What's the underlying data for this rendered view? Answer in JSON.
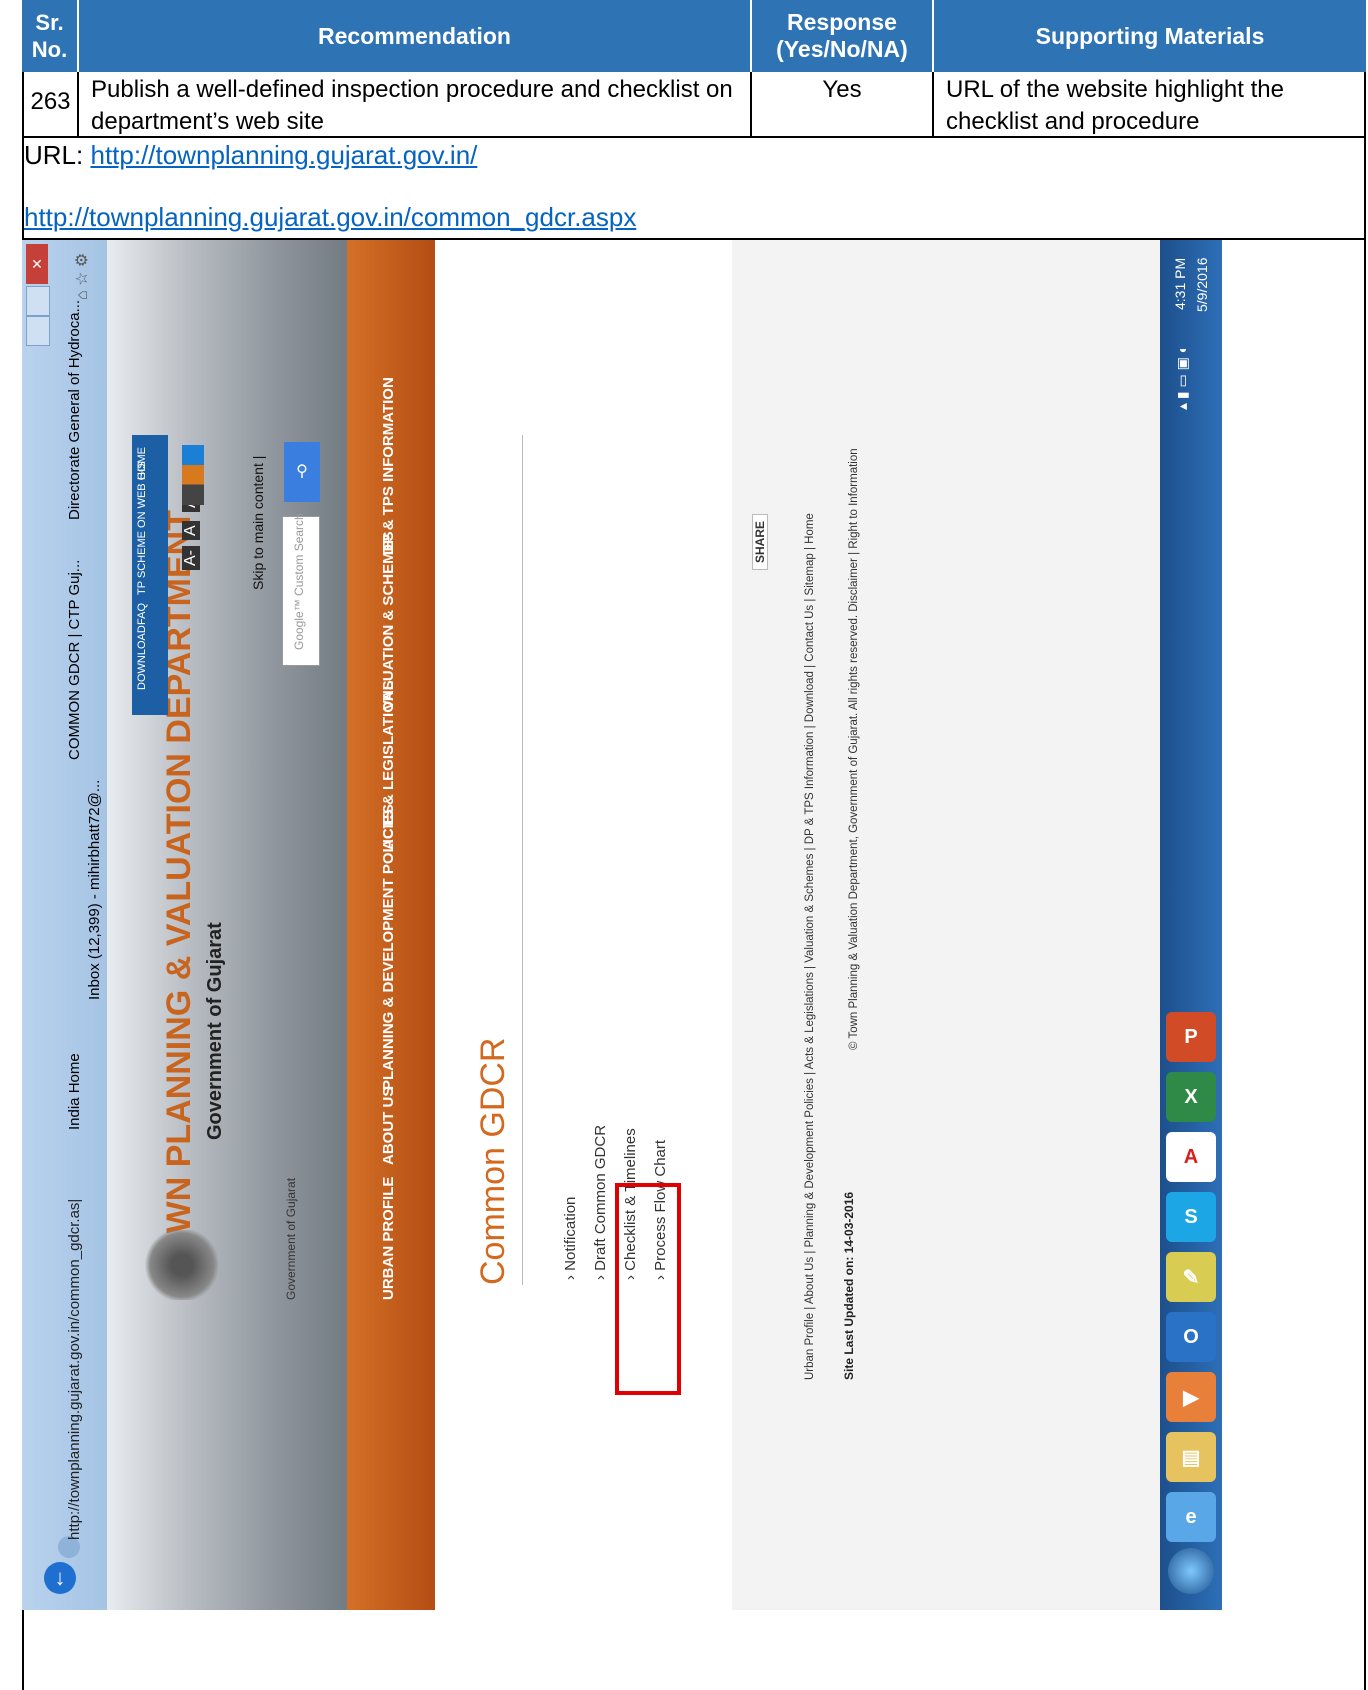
{
  "table": {
    "headers": [
      "Sr.\nNo.",
      "Recommendation",
      "Response\n(Yes/No/NA)",
      "Supporting Materials"
    ],
    "row": {
      "sr_no": "263",
      "recommendation": "Publish a well-defined inspection procedure and checklist on department’s web site",
      "response": "Yes",
      "supporting": "URL of the website highlight the checklist and procedure"
    },
    "url_label": "URL:",
    "url1": "http://townplanning.gujarat.gov.in/",
    "url2": "http://townplanning.gujarat.gov.in/common_gdcr.aspx"
  },
  "browser": {
    "address": "http://townplanning.gujarat.gov.in/common_gdcr.as|",
    "tabs": [
      "India Home",
      "Inbox (12,399) - mihirbhatt72@...",
      "COMMON GDCR | CTP Guj...",
      "Directorate General of Hydroca..."
    ]
  },
  "site": {
    "title": "TOWN PLANNING & VALUATION DEPARTMENT",
    "subtitle": "Government of Gujarat",
    "emblem_caption": "Government of Gujarat",
    "top_links": [
      "DOWNLOAD",
      "FAQ",
      "TP SCHEME ON WEB GIS",
      "HOME"
    ],
    "font_sizes": [
      "A-",
      "A",
      "A+"
    ],
    "skip_link": "Skip to main content | ",
    "search_placeholder": "Google™ Custom Search",
    "menu": [
      "URBAN PROFILE",
      "ABOUT US",
      "PLANNING & DEVELOPMENT POLICIES",
      "ACTS & LEGISLATIONS",
      "VALUATION & SCHEMES",
      "DP & TPS INFORMATION"
    ],
    "page_heading": "Common GDCR",
    "links": [
      "Notification",
      "Draft Common GDCR",
      "Checklist & Timelines",
      "Process Flow Chart"
    ],
    "share": "SHARE",
    "footer_links": "Urban Profile | About Us | Planning & Development Policies | Acts & Legislations | Valuation & Schemes | DP & TPS Information | Download | Contact Us | Sitemap | Home",
    "last_updated": "Site Last Updated on: 14-03-2016",
    "copyright": "© Town Planning & Valuation Department, Government of Gujarat. All rights reserved. Disclaimer | Right to Information"
  },
  "taskbar": {
    "time": "4:31 PM",
    "date": "5/9/2016"
  },
  "colors": {
    "header_blue": "#2e74b5",
    "menu_orange": "#c65f1d",
    "highlight_red": "#e00000",
    "link_blue": "#0563c1"
  }
}
